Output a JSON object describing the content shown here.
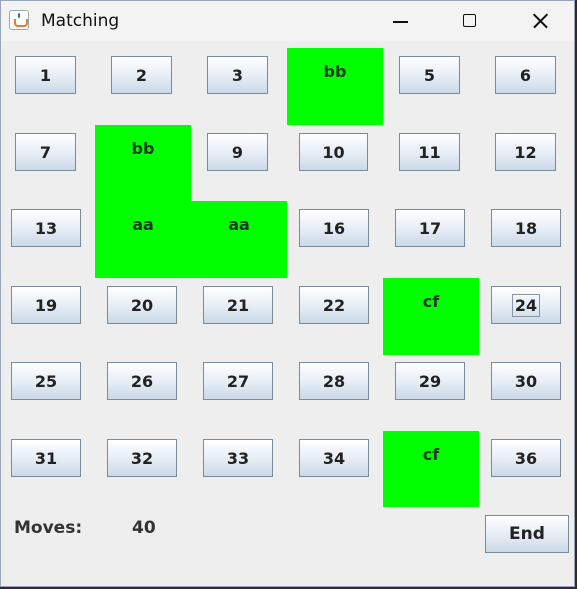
{
  "window": {
    "title": "Matching",
    "icon": "java-cup-icon",
    "controls": [
      "minimize-icon",
      "maximize-icon",
      "close-icon"
    ]
  },
  "tiles": [
    {
      "label": "1",
      "state": "hidden"
    },
    {
      "label": "2",
      "state": "hidden"
    },
    {
      "label": "3",
      "state": "hidden"
    },
    {
      "label": "bb",
      "state": "matched"
    },
    {
      "label": "5",
      "state": "hidden"
    },
    {
      "label": "6",
      "state": "hidden"
    },
    {
      "label": "7",
      "state": "hidden"
    },
    {
      "label": "bb",
      "state": "matched"
    },
    {
      "label": "9",
      "state": "hidden"
    },
    {
      "label": "10",
      "state": "hidden"
    },
    {
      "label": "11",
      "state": "hidden"
    },
    {
      "label": "12",
      "state": "hidden"
    },
    {
      "label": "13",
      "state": "hidden"
    },
    {
      "label": "aa",
      "state": "matched"
    },
    {
      "label": "aa",
      "state": "matched"
    },
    {
      "label": "16",
      "state": "hidden"
    },
    {
      "label": "17",
      "state": "hidden"
    },
    {
      "label": "18",
      "state": "hidden"
    },
    {
      "label": "19",
      "state": "hidden"
    },
    {
      "label": "20",
      "state": "hidden"
    },
    {
      "label": "21",
      "state": "hidden"
    },
    {
      "label": "22",
      "state": "hidden"
    },
    {
      "label": "cf",
      "state": "matched"
    },
    {
      "label": "24",
      "state": "hidden",
      "focused": true
    },
    {
      "label": "25",
      "state": "hidden"
    },
    {
      "label": "26",
      "state": "hidden"
    },
    {
      "label": "27",
      "state": "hidden"
    },
    {
      "label": "28",
      "state": "hidden"
    },
    {
      "label": "29",
      "state": "hidden"
    },
    {
      "label": "30",
      "state": "hidden"
    },
    {
      "label": "31",
      "state": "hidden"
    },
    {
      "label": "32",
      "state": "hidden"
    },
    {
      "label": "33",
      "state": "hidden"
    },
    {
      "label": "34",
      "state": "hidden"
    },
    {
      "label": "cf",
      "state": "matched"
    },
    {
      "label": "36",
      "state": "hidden"
    }
  ],
  "moves": {
    "label": "Moves:",
    "value": "40"
  },
  "end_button": {
    "label": "End"
  },
  "colors": {
    "matched_tile": "#00ff00",
    "background": "#eeeeee"
  }
}
